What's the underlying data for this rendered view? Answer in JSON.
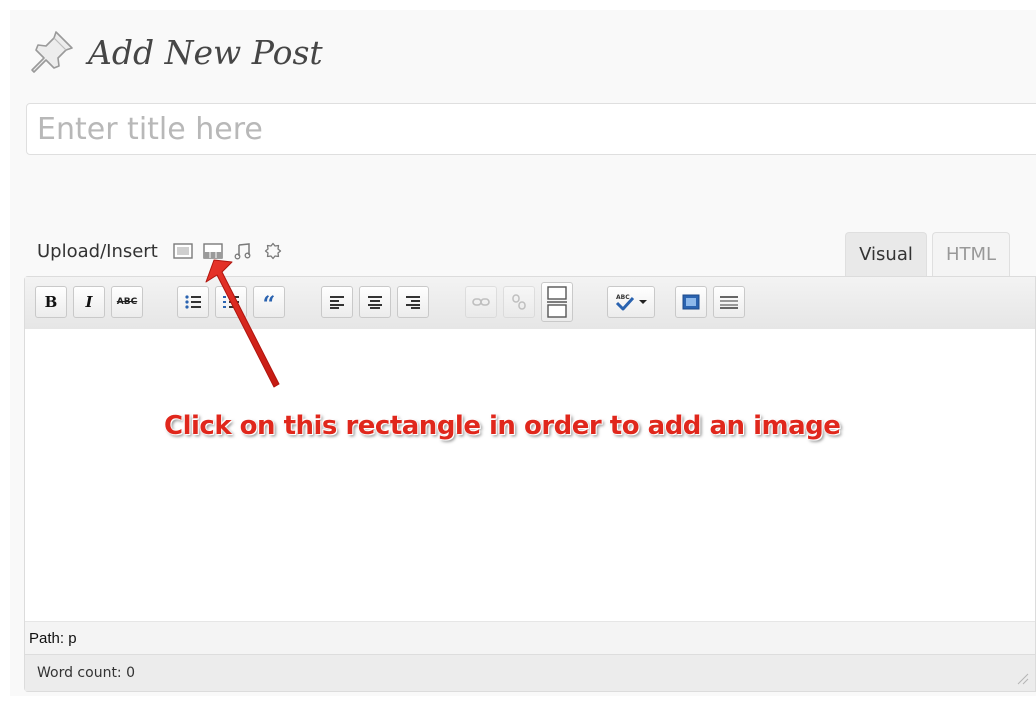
{
  "page": {
    "title": "Add New Post"
  },
  "title_field": {
    "placeholder": "Enter title here",
    "value": ""
  },
  "media_bar": {
    "label": "Upload/Insert",
    "icons": [
      "add-image-icon",
      "add-video-icon",
      "add-audio-icon",
      "add-media-icon"
    ]
  },
  "tabs": {
    "visual": "Visual",
    "html": "HTML",
    "active": "Visual"
  },
  "toolbar": {
    "bold": "B",
    "italic": "I",
    "strikethrough": "ABC",
    "blockquote": "“",
    "buttons": [
      "bold",
      "italic",
      "strikethrough",
      "unordered-list",
      "ordered-list",
      "blockquote",
      "align-left",
      "align-center",
      "align-right",
      "insert-link",
      "unlink",
      "insert-more",
      "spellcheck",
      "fullscreen",
      "kitchen-sink"
    ]
  },
  "annotation": {
    "text": "Click on this rectangle in order to add an image",
    "color": "#e0271c"
  },
  "status": {
    "path": "Path: p",
    "word_count": "Word count: 0"
  }
}
